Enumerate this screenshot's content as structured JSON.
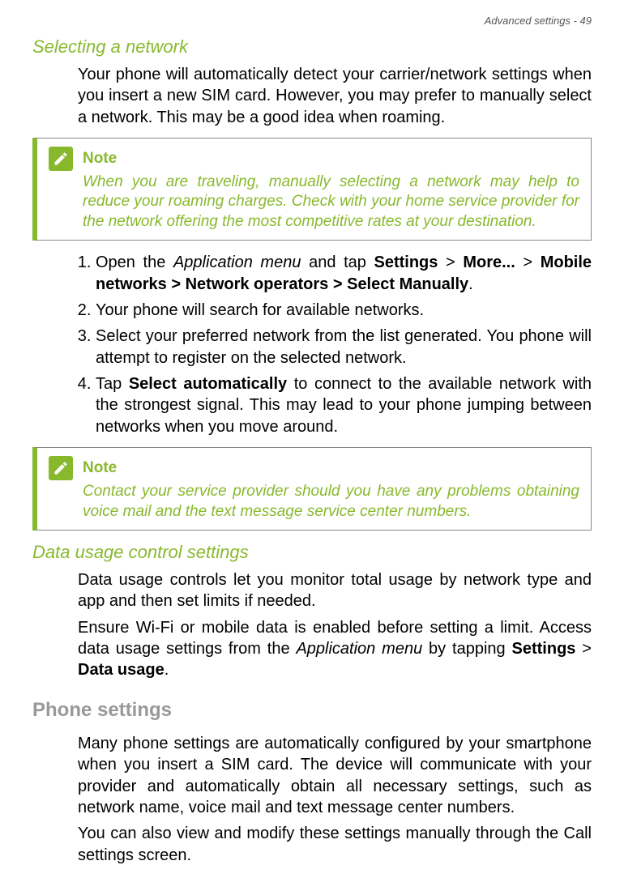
{
  "header": {
    "running_head": "Advanced settings - 49"
  },
  "section1": {
    "heading": "Selecting a network",
    "intro": "Your phone will automatically detect your carrier/network settings when you insert a new SIM card. However, you may prefer to manually select a network. This may be a good idea when roaming."
  },
  "note1": {
    "title": "Note",
    "body": "When you are traveling, manually selecting a network may help to reduce your roaming charges. Check with your home service provider for the network offering the most competitive rates at your destination."
  },
  "steps": {
    "s1_a": "Open the ",
    "s1_b": "Application menu",
    "s1_c": " and tap ",
    "s1_d": "Settings",
    "s1_e": " > ",
    "s1_f": "More...",
    "s1_g": " > ",
    "s1_h": "Mobile networks > Network operators > Select Manually",
    "s1_i": ".",
    "s2": "Your phone will search for available networks.",
    "s3": "Select your preferred network from the list generated. You phone will attempt to register on the selected network.",
    "s4_a": "Tap ",
    "s4_b": "Select automatically",
    "s4_c": " to connect to the available network with the strongest signal. This may lead to your phone jumping between networks when you move around."
  },
  "note2": {
    "title": "Note",
    "body": "Contact your service provider should you have any problems obtaining voice mail and the text message service center numbers."
  },
  "section2": {
    "heading": "Data usage control settings",
    "p1": "Data usage controls let you monitor total usage by network type and app and then set limits if needed.",
    "p2_a": "Ensure Wi-Fi or mobile data is enabled before setting a limit. Access data usage settings from the ",
    "p2_b": "Application menu",
    "p2_c": " by tapping ",
    "p2_d": "Settings",
    "p2_e": " > ",
    "p2_f": "Data usage",
    "p2_g": "."
  },
  "section3": {
    "heading": "Phone settings",
    "p1": "Many phone settings are automatically configured by your smartphone when you insert a SIM card. The device will communicate with your provider and automatically obtain all necessary settings, such as network name, voice mail and text message center numbers.",
    "p2": "You can also view and modify these settings manually through the Call settings screen."
  }
}
